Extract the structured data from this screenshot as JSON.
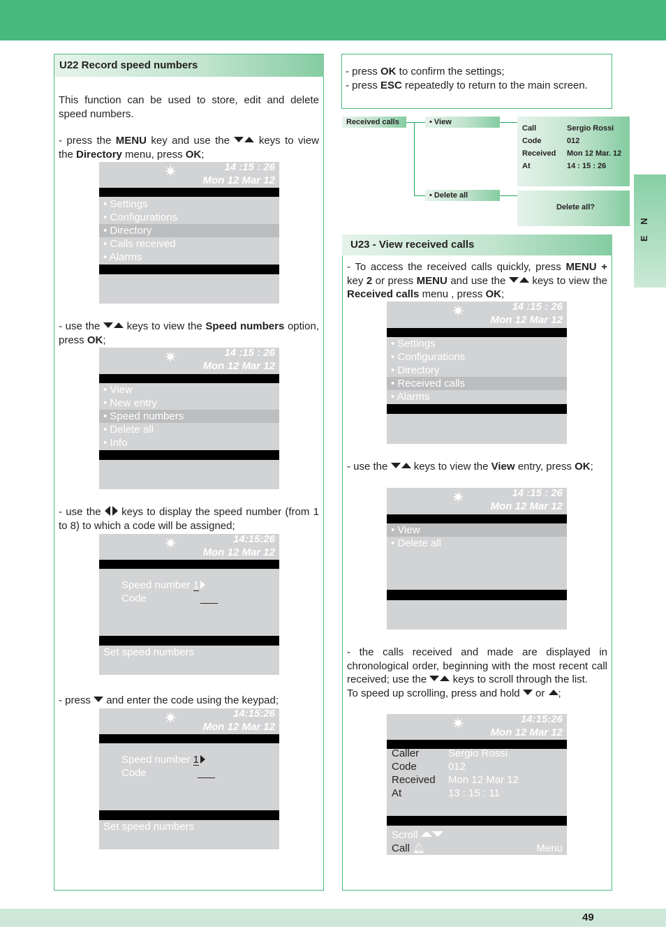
{
  "page": {
    "number": "49",
    "language_tab": "E N",
    "colors": {
      "accent": "#46b97c",
      "footer": "#cde8d8",
      "lcd_bg": "#d2d3d5",
      "lcd_selected": "#bcbdbf"
    }
  },
  "left": {
    "title": "U22 Record speed numbers",
    "intro": "This function can be used to store, edit and delete speed numbers.",
    "step1": {
      "a": "- press the ",
      "b1": "MENU",
      "c": " key and use the ",
      "d": " keys to view the ",
      "b2": "Directory",
      "e": " menu, press ",
      "b3": "OK",
      "f": ";"
    },
    "step2": {
      "a": "- use the ",
      "d": " keys to view the ",
      "b1": "Speed numbers",
      "e": " option, press ",
      "b2": "OK",
      "f": ";"
    },
    "step3": {
      "a": "- use the ",
      "d": " keys to display the speed number (from 1 to 8) to which a code will be assigned;"
    },
    "step4": {
      "a": "- press ",
      "d": " and enter the code using the keypad;"
    },
    "screen1": {
      "time": "14 :15 : 26",
      "date": "Mon 12 Mar 12",
      "items": [
        "• Settings",
        "• Configurations",
        "• Directory",
        "• Calls received",
        "• Alarms"
      ],
      "selected_index": 2
    },
    "screen2": {
      "time": "14 :15 : 26",
      "date": "Mon 12 Mar 12",
      "items": [
        "• View",
        "• New entry",
        "• Speed numbers",
        "• Delete all",
        "• Info"
      ],
      "selected_index": 2
    },
    "screen3": {
      "time": "14:15:26",
      "date": "Mon 12 Mar 12",
      "speed_label": "Speed number ",
      "speed_value": "1",
      "code_label": "Code",
      "code_value": "___",
      "footer": "Set speed numbers"
    },
    "screen4": {
      "time": "14:15:26",
      "date": "Mon 12 Mar 12",
      "speed_label": "Speed number ",
      "speed_value": "1",
      "code_label": "Code",
      "code_value": "___",
      "footer": "Set speed numbers"
    }
  },
  "right_top": {
    "line1": {
      "a": "- press ",
      "b": "OK",
      "c": " to confirm the settings;"
    },
    "line2": {
      "a": "- press ",
      "b": "ESC",
      "c": " repeatedly to return to the main screen."
    }
  },
  "tree": {
    "root": "Received calls",
    "view": "• View",
    "delete_all": "• Delete all",
    "view_detail": [
      {
        "label": "Call",
        "value": "Sergio Rossi"
      },
      {
        "label": "Code",
        "value": "012"
      },
      {
        "label": "Received",
        "value": "Mon 12 Mar. 12"
      },
      {
        "label": "At",
        "value": "14 : 15 : 26"
      }
    ],
    "delete_prompt": "Delete all?"
  },
  "right": {
    "title": "U23 - View received calls",
    "step1": {
      "a": "- To access the received calls quickly, press ",
      "b1": "MENU +",
      "c": " key ",
      "b2": "2",
      "d": " or press ",
      "b3": "MENU",
      "e": " and use the ",
      "f": " keys to view the ",
      "b4": "Received calls",
      "g": " menu , press ",
      "b5": "OK",
      "h": ";"
    },
    "step2": {
      "a": "- use the ",
      "d": " keys to view the ",
      "b1": "View",
      "e": " entry, press ",
      "b2": "OK",
      "f": ";"
    },
    "step3": {
      "a": "- the calls received and made are displayed in chronological order, beginning with the most recent call received; use the ",
      "d": " keys to scroll through the list.",
      "e": "To speed up scrolling, press and hold ",
      "f": " or ",
      "g": ";"
    },
    "screen1": {
      "time": "14 :15 : 26",
      "date": "Mon 12 Mar 12",
      "items": [
        "• Settings",
        "• Configurations",
        "• Directory",
        "• Received calls",
        "• Alarms"
      ],
      "selected_index": 3
    },
    "screen2": {
      "time": "14 :15 : 26",
      "date": "Mon 12 Mar 12",
      "items": [
        "• View",
        "• Delete all"
      ],
      "selected_index": 0
    },
    "screen3": {
      "time": "14:15:26",
      "date": "Mon 12 Mar 12",
      "rows": [
        {
          "label": "Caller",
          "value": "Sergio Rossi"
        },
        {
          "label": "Code",
          "value": "012"
        },
        {
          "label": "Received",
          "value": "Mon 12 Mar 12"
        },
        {
          "label": "At",
          "value": "13 : 15 : 11"
        }
      ],
      "scroll_label": "Scroll",
      "call_label": "Call",
      "menu_label": "Menu"
    }
  }
}
